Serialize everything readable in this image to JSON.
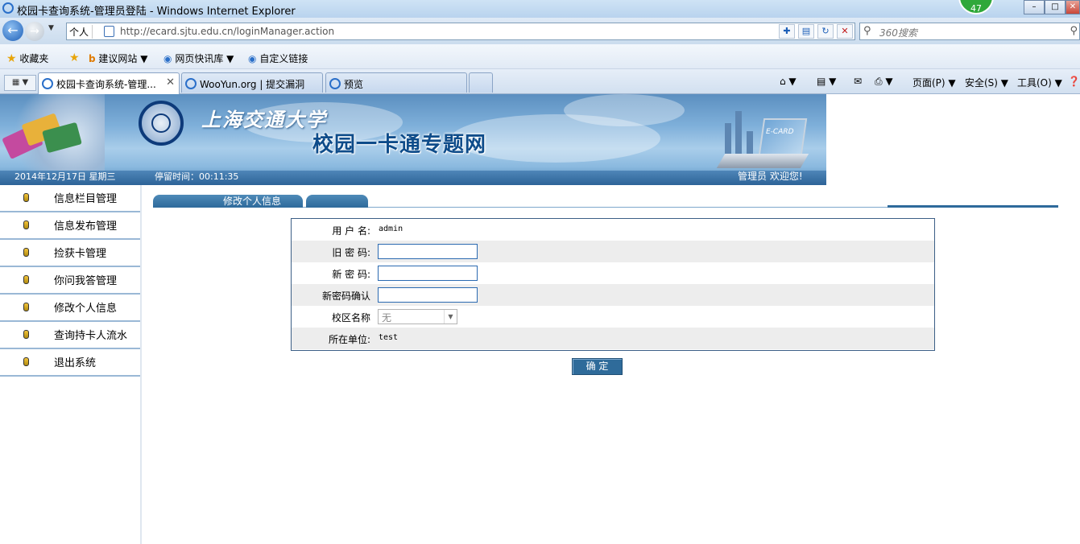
{
  "window": {
    "title": "校园卡查询系统-管理员登陆 - Windows Internet Explorer",
    "badge": "47"
  },
  "addressbar": {
    "persona": "个人",
    "url": "http://ecard.sjtu.edu.cn/loginManager.action",
    "search_placeholder": "360搜索"
  },
  "favorites": {
    "label": "收藏夹",
    "items": [
      "建议网站",
      "网页快讯库",
      "自定义链接"
    ]
  },
  "tabs": [
    {
      "label": "校园卡查询系统-管理..."
    },
    {
      "label": "WooYun.org | 提交漏洞"
    },
    {
      "label": "预览"
    }
  ],
  "commandbar": {
    "page": "页面(P)",
    "safety": "安全(S)",
    "tools": "工具(O)"
  },
  "banner": {
    "university": "上海交通大学",
    "site_name": "校园一卡通专题网",
    "ecard": "E-CARD",
    "date": "2014年12月17日  星期三",
    "stay_time": "停留时间：00:11:35",
    "welcome": "管理员   欢迎您!"
  },
  "sidebar": {
    "items": [
      "信息栏目管理",
      "信息发布管理",
      "捡获卡管理",
      "你问我答管理",
      "修改个人信息",
      "查询持卡人流水",
      "退出系统"
    ]
  },
  "page_tabs": {
    "active": "修改个人信息",
    "second": ""
  },
  "form": {
    "username_label": "用 户 名:",
    "username_value": "admin",
    "old_pw_label": "旧 密 码:",
    "new_pw_label": "新 密 码:",
    "confirm_label": "新密码确认",
    "campus_label": "校区名称",
    "campus_value": "无",
    "unit_label": "所在单位:",
    "unit_value": "test",
    "submit": "确 定"
  }
}
